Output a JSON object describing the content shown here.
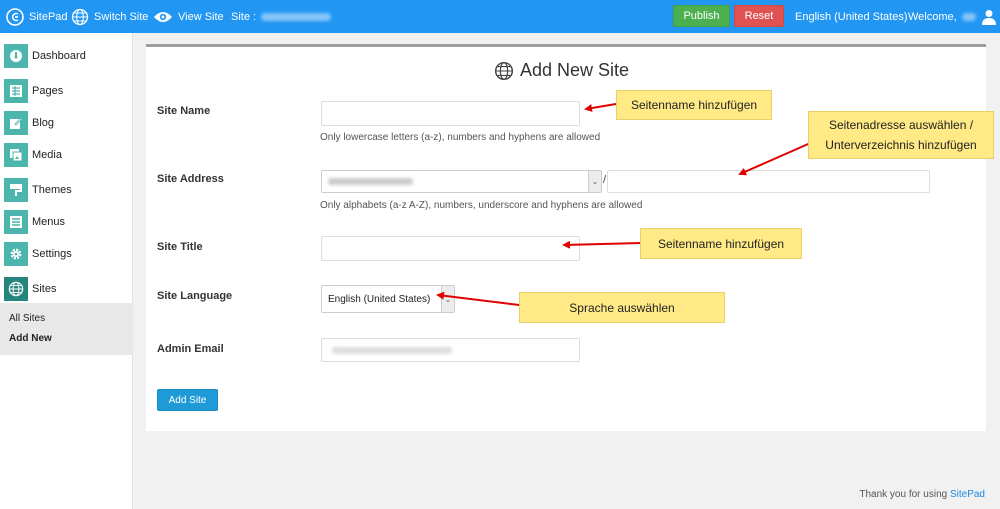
{
  "topbar": {
    "brand": "SitePad",
    "switch_site": "Switch Site",
    "view_site": "View Site",
    "site_label": "Site :",
    "publish": "Publish",
    "reset": "Reset",
    "language": "English (United States)",
    "welcome": "Welcome,"
  },
  "sidebar": {
    "items": [
      {
        "label": "Dashboard",
        "icon": "dashboard-icon"
      },
      {
        "label": "Pages",
        "icon": "pages-icon"
      },
      {
        "label": "Blog",
        "icon": "blog-icon"
      },
      {
        "label": "Media",
        "icon": "media-icon"
      },
      {
        "label": "Themes",
        "icon": "themes-icon"
      },
      {
        "label": "Menus",
        "icon": "menus-icon"
      },
      {
        "label": "Settings",
        "icon": "gear-icon"
      },
      {
        "label": "Sites",
        "icon": "globe-icon"
      }
    ],
    "submenu": [
      "All Sites",
      "Add New"
    ]
  },
  "form": {
    "title": "Add New Site",
    "site_name_label": "Site Name",
    "site_name_help": "Only lowercase letters (a-z), numbers and hyphens are allowed",
    "site_address_label": "Site Address",
    "site_address_sep": "/",
    "site_address_help": "Only alphabets (a-z A-Z), numbers, underscore and hyphens are allowed",
    "site_title_label": "Site Title",
    "site_language_label": "Site Language",
    "site_language_value": "English (United States)",
    "admin_email_label": "Admin Email",
    "submit": "Add Site"
  },
  "callouts": {
    "site_name": "Seitenname hinzufügen",
    "site_address": "Seitenadresse auswählen / Unterverzeichnis hinzufügen",
    "site_title": "Seitenname hinzufügen",
    "language": "Sprache auswählen"
  },
  "footer": {
    "text": "Thank you for using",
    "link": "SitePad"
  },
  "colors": {
    "topbar": "#2196f3",
    "sidebar_icon": "#4db6ac",
    "publish": "#4caf50",
    "reset": "#e05252",
    "primary_button": "#1e9bd7",
    "callout": "#ffea85",
    "arrow": "#e00000"
  }
}
